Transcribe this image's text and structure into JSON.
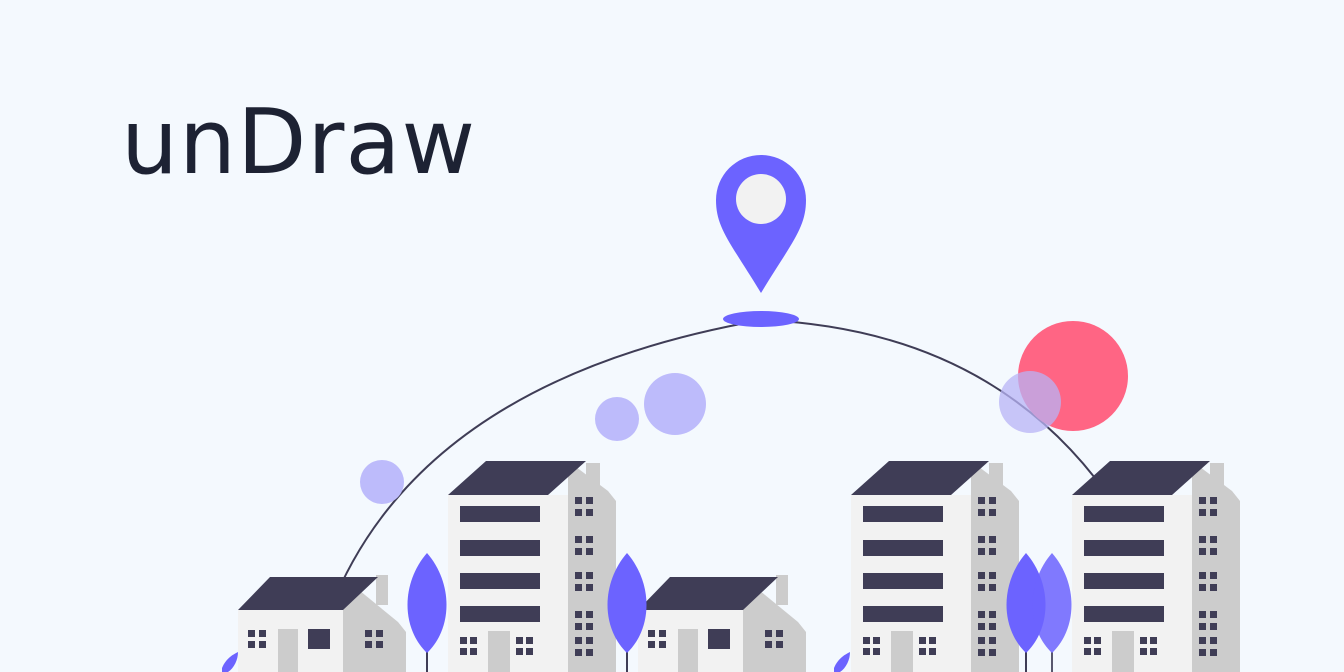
{
  "brand": {
    "name": "unDraw"
  },
  "colors": {
    "background": "#f4f9fe",
    "text": "#1d2233",
    "accent": "#6c63ff",
    "accent_light": "#bdbbfb",
    "building_light": "#f2f2f2",
    "building_shade": "#cccccc",
    "building_dark": "#3f3d56",
    "pink": "#ff6584"
  },
  "illustration": {
    "icons": [
      "location-pin-icon",
      "city-skyline",
      "tree-icon",
      "bubble"
    ]
  }
}
